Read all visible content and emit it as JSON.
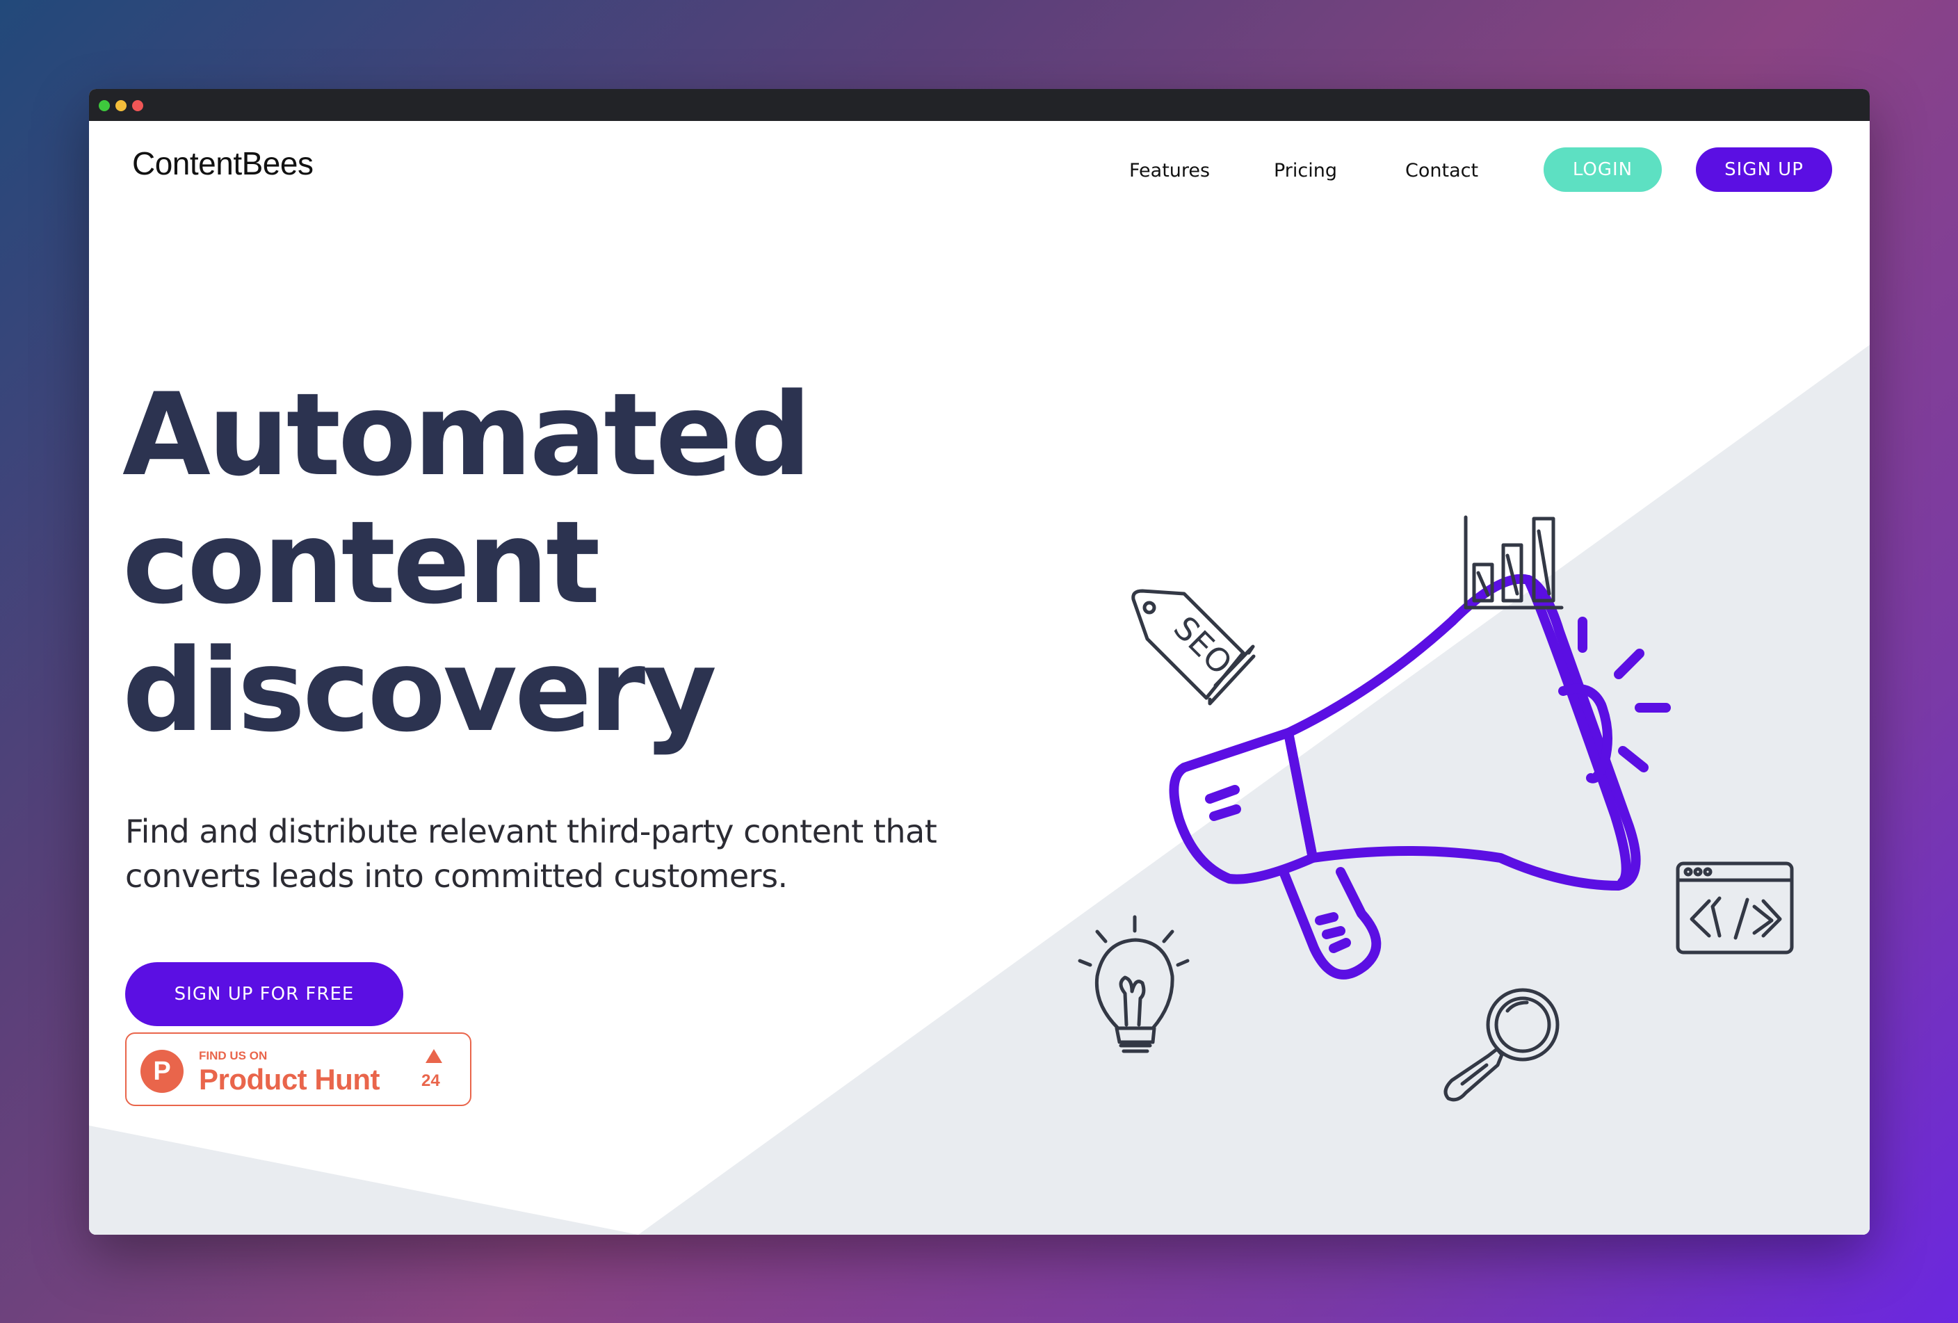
{
  "window": {
    "traffic_lights": [
      "#3ec93d",
      "#f4be3b",
      "#ef5656"
    ]
  },
  "header": {
    "logo": "ContentBees",
    "nav": [
      {
        "label": "Features"
      },
      {
        "label": "Pricing"
      },
      {
        "label": "Contact"
      }
    ],
    "login_label": "LOGIN",
    "signup_label": "SIGN UP"
  },
  "hero": {
    "title_lines": [
      "Automated",
      "content",
      "discovery"
    ],
    "subtitle_lines": [
      "Find and distribute relevant third-party content that",
      "converts leads into committed customers."
    ],
    "cta_label": "SIGN UP FOR FREE"
  },
  "product_hunt": {
    "small": "FIND US ON",
    "big": "Product Hunt",
    "logo_letter": "P",
    "votes": "24"
  },
  "illustration": {
    "icons": [
      "megaphone-icon",
      "seo-tag-icon",
      "bar-chart-icon",
      "code-window-icon",
      "lightbulb-icon",
      "magnifier-icon"
    ],
    "seo_text": "SEO"
  },
  "colors": {
    "primary": "#5b0fe3",
    "accent": "#5de0c2",
    "heading": "#2c3350",
    "product_hunt": "#e9654b",
    "panel": "#e9ecf0"
  }
}
